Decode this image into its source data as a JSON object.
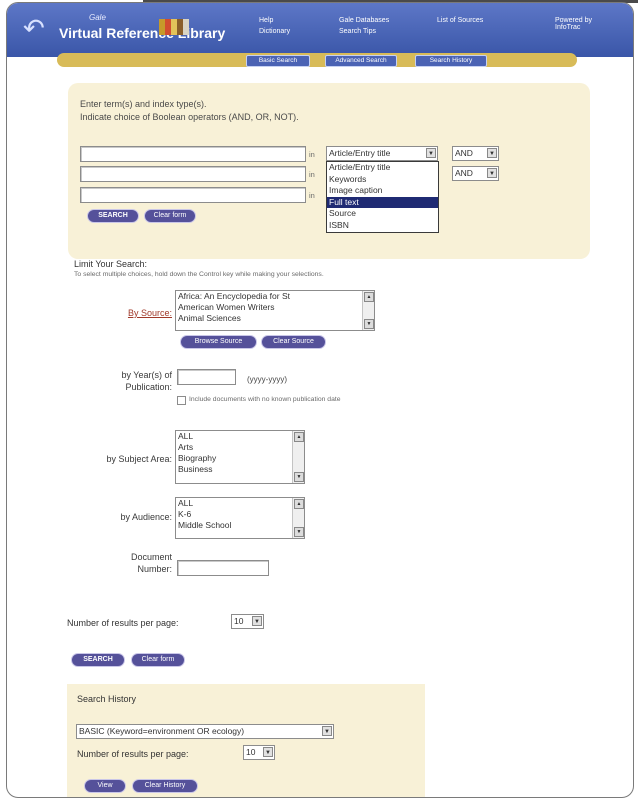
{
  "header": {
    "brand_small": "Gale",
    "app_title": "Virtual Reference Library",
    "nav_links": [
      "Help",
      "Dictionary",
      "Gale Databases",
      "Search Tips",
      "List of Sources",
      "Powered by InfoTrac"
    ],
    "tabs": [
      "Basic Search",
      "Advanced Search",
      "Search History"
    ]
  },
  "advanced_search": {
    "instructions_line1": "Enter term(s) and index type(s).",
    "instructions_line2": "Indicate choice of Boolean operators (AND, OR, NOT).",
    "rows": [
      {
        "term": "",
        "in_label": "in",
        "index_value": "Article/Entry title",
        "operator": "AND"
      },
      {
        "term": "",
        "in_label": "in",
        "index_value": "",
        "operator": "AND"
      },
      {
        "term": "",
        "in_label": "in",
        "index_value": "",
        "operator": ""
      }
    ],
    "index_dropdown_options": [
      "Article/Entry title",
      "Keywords",
      "Image caption",
      "Full text",
      "Source",
      "ISBN"
    ],
    "index_dropdown_selected": "Full text",
    "search_button": "SEARCH",
    "clear_button": "Clear form"
  },
  "limits": {
    "heading": "Limit Your Search:",
    "hint": "To select multiple choices, hold down the Control key while making your selections.",
    "by_source_label": "By Source:",
    "source_options": [
      "Africa: An Encyclopedia for St",
      "American Women Writers",
      "Animal Sciences"
    ],
    "source_browse_button": "Browse Source",
    "source_clear_button": "Clear Source",
    "year_label_line1": "by Year(s) of",
    "year_label_line2": "Publication:",
    "year_value": "",
    "year_format": "(yyyy-yyyy)",
    "include_unknown_date": "Include documents with no known publication date",
    "subject_label": "by Subject Area:",
    "subject_options": [
      "ALL",
      "Arts",
      "Biography",
      "Business"
    ],
    "audience_label": "by Audience:",
    "audience_options": [
      "ALL",
      "K-6",
      "Middle School"
    ],
    "document_label_line1": "Document",
    "document_label_line2": "Number:",
    "document_value": ""
  },
  "results": {
    "per_page_label": "Number of results per page:",
    "per_page_value": "10",
    "search_button": "SEARCH",
    "clear_button": "Clear form"
  },
  "history": {
    "title": "Search History",
    "selected_search": "BASIC (Keyword=environment OR ecology)",
    "per_page_label": "Number of results per page:",
    "per_page_value": "10",
    "view_button": "View",
    "clear_button": "Clear History"
  }
}
